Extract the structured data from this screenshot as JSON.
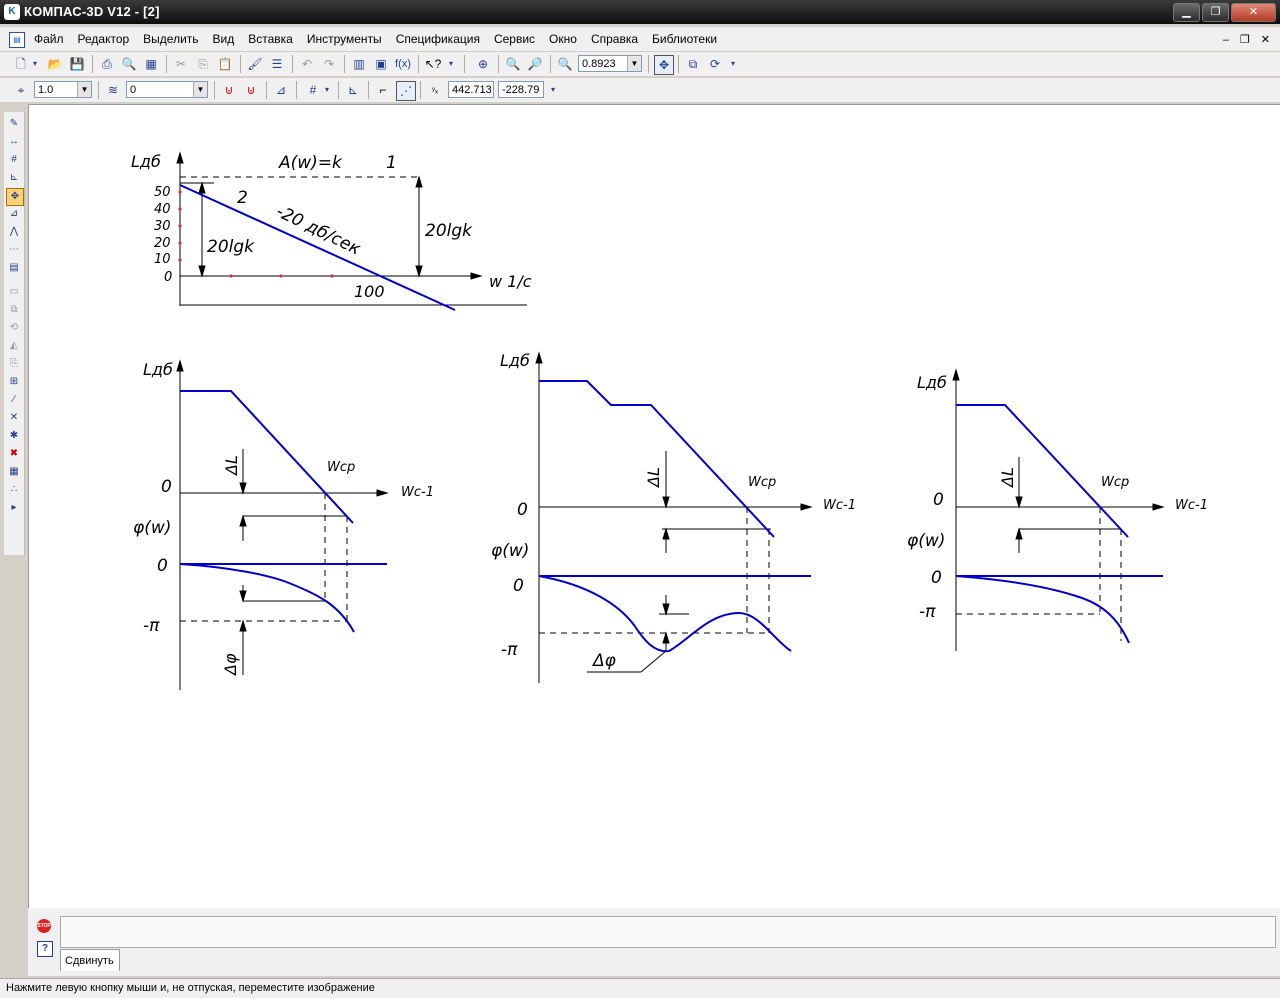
{
  "window": {
    "title": "КОМПАС-3D V12 - [2]",
    "app_icon_label": "K"
  },
  "menu": {
    "items": [
      "Файл",
      "Редактор",
      "Выделить",
      "Вид",
      "Вставка",
      "Инструменты",
      "Спецификация",
      "Сервис",
      "Окно",
      "Справка",
      "Библиотеки"
    ]
  },
  "toolbar": {
    "zoom_value": "0.8923"
  },
  "toolbar2": {
    "step_value": "1.0",
    "layer_value": "0",
    "coord_x": "442.713",
    "coord_y": "-228.79"
  },
  "drawing": {
    "top": {
      "ylabel": "Lдб",
      "formula": "A(w)=k",
      "label_1": "1",
      "label_2": "2",
      "slope": "-20 дб/сек",
      "gain_right": "20lgk",
      "gain_left": "20lgk",
      "xlabel": "w 1/c",
      "x100": "100",
      "ticks": [
        "50",
        "40",
        "30",
        "20",
        "10",
        "0"
      ]
    },
    "plot1": {
      "ylabel": "Lдб",
      "zero_top": "0",
      "delta_l": "ΔL",
      "wcp": "Wср",
      "xlabel": "Wс-1",
      "phi": "φ(w)",
      "zero_bottom": "0",
      "minus_pi": "-π",
      "delta_phi": "Δφ"
    },
    "plot2": {
      "ylabel": "Lдб",
      "zero_top": "0",
      "delta_l": "ΔL",
      "wcp": "Wср",
      "xlabel": "Wс-1",
      "phi": "φ(w)",
      "zero_bottom": "0",
      "minus_pi": "-π",
      "delta_phi": "Δφ"
    },
    "plot3": {
      "ylabel": "Lдб",
      "zero_top": "0",
      "delta_l": "ΔL",
      "wcp": "Wср",
      "xlabel": "Wс-1",
      "phi": "φ(w)",
      "zero_bottom": "0",
      "minus_pi": "-π"
    }
  },
  "panel": {
    "tab_label": "Сдвинуть",
    "stop_label": "STOP",
    "help_label": "?"
  },
  "status": {
    "text": "Нажмите левую кнопку мыши и, не отпуская, переместите изображение"
  },
  "colors": {
    "curve": "#0000cc",
    "title_bg": "#1a1a1a"
  }
}
